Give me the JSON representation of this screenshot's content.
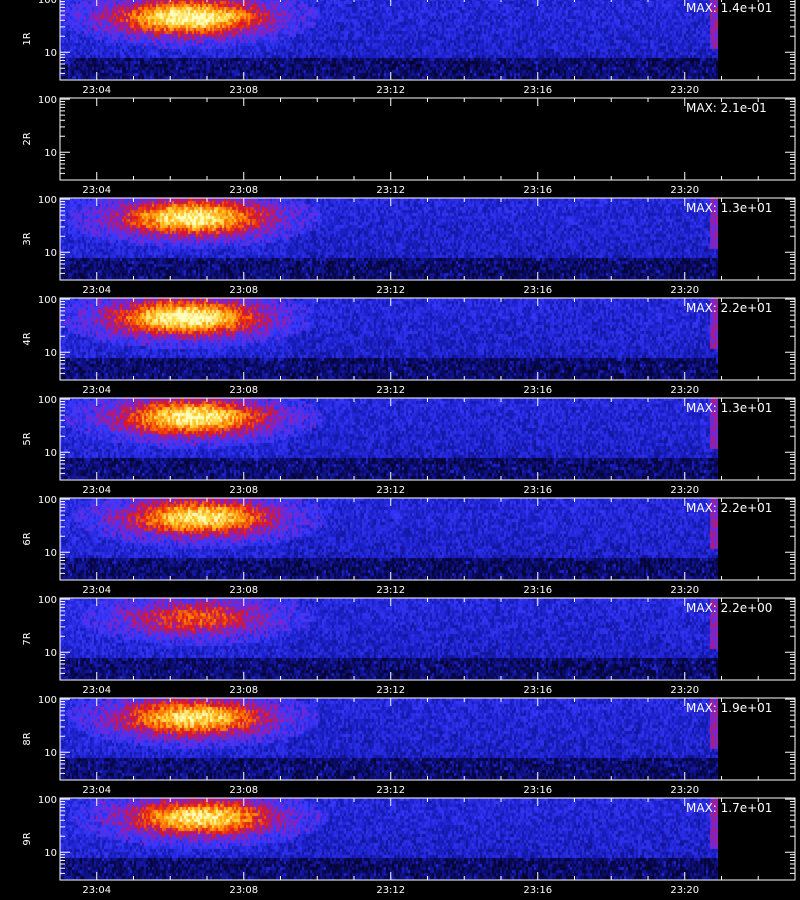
{
  "chart_data": {
    "type": "heatmap",
    "time_ticks": [
      "23:04",
      "23:08",
      "23:12",
      "23:16",
      "23:20"
    ],
    "tick_minutes": [
      4,
      8,
      12,
      16,
      20
    ],
    "x_range_minutes": [
      3,
      23
    ],
    "data_end_minute": 20.9,
    "step_minute": 9.2,
    "y_ticks": [
      "100",
      "10"
    ],
    "y_tick_values": [
      100,
      10
    ],
    "y_range": [
      3,
      105
    ],
    "y_scale": "log",
    "max_label_prefix": "MAX:",
    "colors": {
      "background": "#000000",
      "axis": "#ffffff",
      "colormap": [
        "#000000",
        "#0a0a60",
        "#1a20c8",
        "#3a3aff",
        "#8a20c0",
        "#e01818",
        "#ff7a00",
        "#ffd030",
        "#ffffc0"
      ]
    },
    "panels": [
      {
        "label": "1R",
        "max": "MAX: 1.4e+01",
        "has_data": true,
        "blob_center_minute": 6.5,
        "blob_intensity": 1.0
      },
      {
        "label": "2R",
        "max": "MAX: 2.1e-01",
        "has_data": false,
        "blob_center_minute": 6.5,
        "blob_intensity": 0.0
      },
      {
        "label": "3R",
        "max": "MAX: 1.3e+01",
        "has_data": true,
        "blob_center_minute": 6.6,
        "blob_intensity": 0.95
      },
      {
        "label": "4R",
        "max": "MAX: 2.2e+01",
        "has_data": true,
        "blob_center_minute": 6.4,
        "blob_intensity": 1.0
      },
      {
        "label": "5R",
        "max": "MAX: 1.3e+01",
        "has_data": true,
        "blob_center_minute": 6.6,
        "blob_intensity": 0.95
      },
      {
        "label": "6R",
        "max": "MAX: 2.2e+01",
        "has_data": true,
        "blob_center_minute": 6.8,
        "blob_intensity": 0.9
      },
      {
        "label": "7R",
        "max": "MAX: 2.2e+00",
        "has_data": true,
        "blob_center_minute": 6.7,
        "blob_intensity": 0.55
      },
      {
        "label": "8R",
        "max": "MAX: 1.9e+01",
        "has_data": true,
        "blob_center_minute": 6.6,
        "blob_intensity": 0.9
      },
      {
        "label": "9R",
        "max": "MAX: 1.7e+01",
        "has_data": true,
        "blob_center_minute": 6.8,
        "blob_intensity": 0.9
      }
    ]
  }
}
